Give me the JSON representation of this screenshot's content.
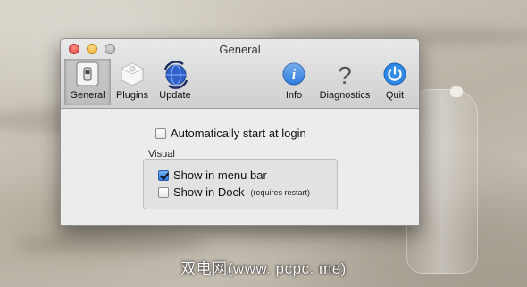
{
  "window": {
    "title": "General"
  },
  "toolbar": {
    "items": [
      {
        "label": "General",
        "icon": "switch-icon",
        "selected": true
      },
      {
        "label": "Plugins",
        "icon": "plugin-block-icon",
        "selected": false
      },
      {
        "label": "Update",
        "icon": "update-globe-icon",
        "selected": false
      },
      {
        "label": "Info",
        "icon": "info-icon",
        "selected": false
      },
      {
        "label": "Diagnostics",
        "icon": "question-icon",
        "selected": false
      },
      {
        "label": "Quit",
        "icon": "power-icon",
        "selected": false
      }
    ]
  },
  "general": {
    "auto_start_label": "Automatically start at login",
    "auto_start_checked": false,
    "visual_section_label": "Visual",
    "show_menu_bar_label": "Show in menu bar",
    "show_menu_bar_checked": true,
    "show_dock_label": "Show in Dock",
    "show_dock_checked": false,
    "show_dock_note": "(requires restart)"
  },
  "watermark": {
    "text": "双电网(www. pcpc. me)"
  },
  "colors": {
    "accent_blue": "#2b7bdc",
    "window_bg": "#ececec"
  }
}
